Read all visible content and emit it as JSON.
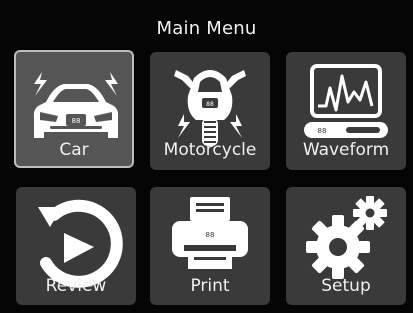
{
  "header": {
    "title": "Main Menu"
  },
  "menu": {
    "items": [
      {
        "label": "Car",
        "icon": "car-icon",
        "selected": true
      },
      {
        "label": "Motorcycle",
        "icon": "motorcycle-icon",
        "selected": false
      },
      {
        "label": "Waveform",
        "icon": "waveform-icon",
        "selected": false
      },
      {
        "label": "Review",
        "icon": "review-icon",
        "selected": false
      },
      {
        "label": "Print",
        "icon": "printer-icon",
        "selected": false
      },
      {
        "label": "Setup",
        "icon": "gear-icon",
        "selected": false
      }
    ]
  },
  "colors": {
    "background": "#050505",
    "tile": "#3a3a3a",
    "tile_selected": "#555555",
    "icon": "#ffffff",
    "text": "#f0f0f0"
  }
}
